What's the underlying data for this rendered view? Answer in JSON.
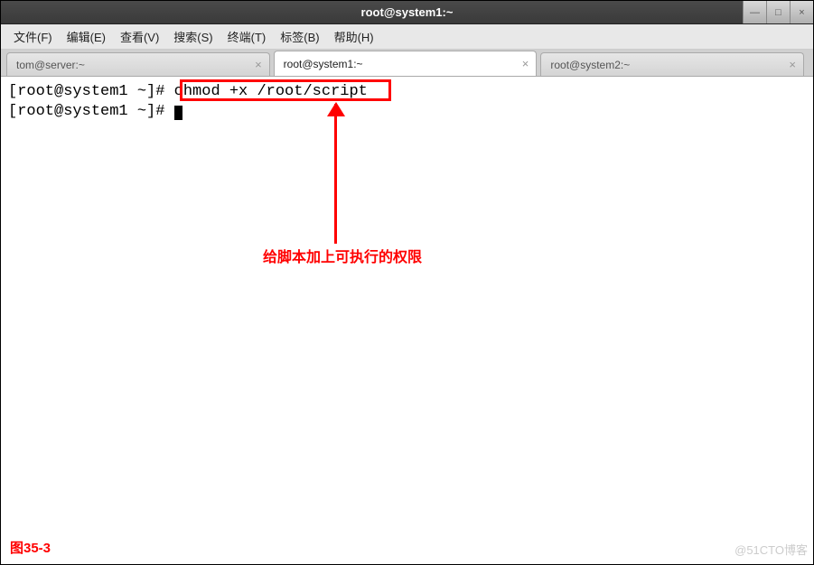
{
  "window": {
    "title": "root@system1:~"
  },
  "menus": {
    "file": "文件(F)",
    "edit": "编辑(E)",
    "view": "查看(V)",
    "search": "搜索(S)",
    "terminal": "终端(T)",
    "tabs": "标签(B)",
    "help": "帮助(H)"
  },
  "tabs": [
    {
      "label": "tom@server:~",
      "active": false
    },
    {
      "label": "root@system1:~",
      "active": true
    },
    {
      "label": "root@system2:~",
      "active": false
    }
  ],
  "terminal": {
    "prompt1": "[root@system1 ~]# ",
    "cmd1": "chmod +x /root/script",
    "prompt2": "[root@system1 ~]# "
  },
  "annotation": {
    "text": "给脚本加上可执行的权限"
  },
  "figure_label": "图35-3",
  "watermark": "@51CTO博客"
}
